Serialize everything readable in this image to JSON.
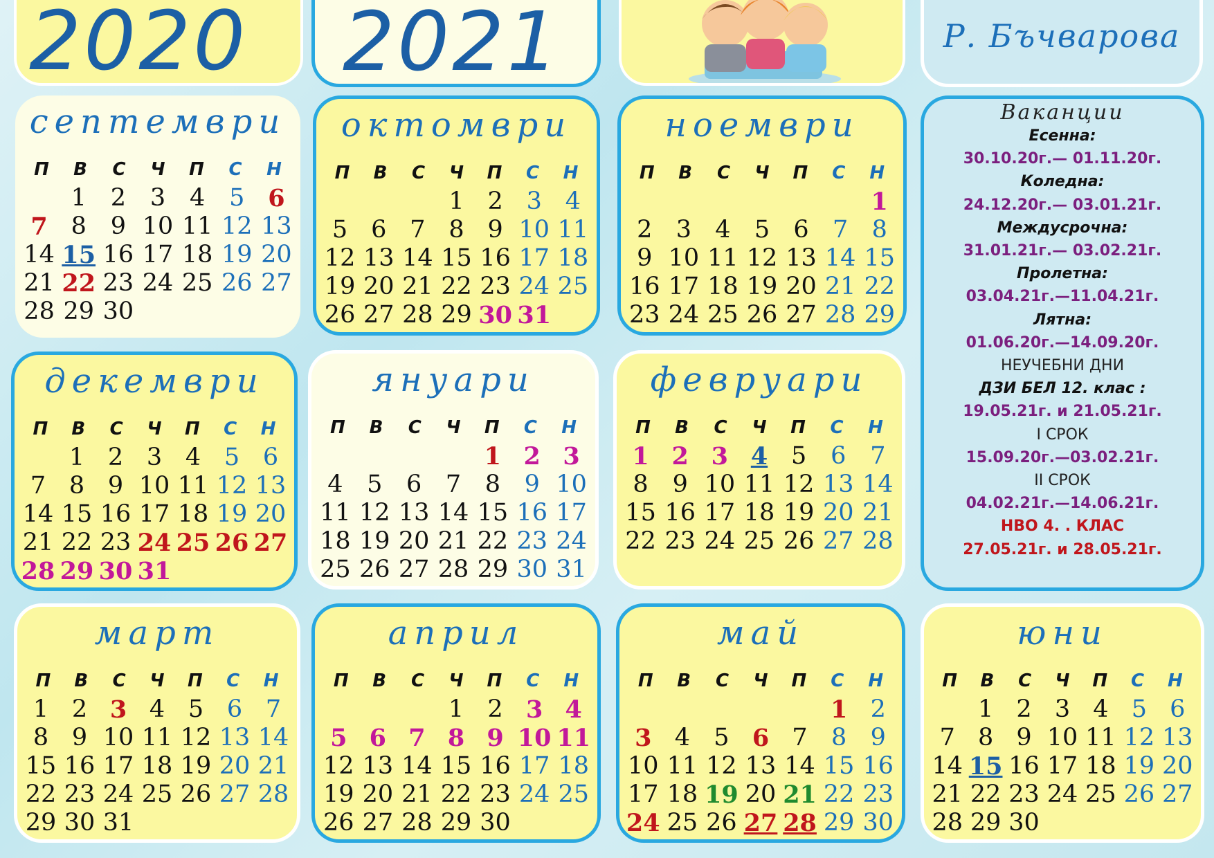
{
  "header": {
    "year1": "2020",
    "year2": "2021",
    "author": "Р. Бъчварова"
  },
  "weekdays": [
    "П",
    "В",
    "С",
    "Ч",
    "П",
    "С",
    "Н"
  ],
  "months": [
    {
      "name": "септември",
      "lead": 1,
      "days": [
        30
      ],
      "red": [
        6,
        7,
        22
      ],
      "mag": [],
      "grn": [],
      "ublu": [
        15
      ],
      "und": []
    },
    {
      "name": "октомври",
      "lead": 3,
      "days": [
        31
      ],
      "red": [],
      "mag": [
        30,
        31
      ],
      "grn": [],
      "ublu": [],
      "und": []
    },
    {
      "name": "ноември",
      "lead": 6,
      "days": [
        30
      ],
      "red": [],
      "mag": [
        1
      ],
      "grn": [],
      "ublu": [],
      "und": []
    },
    {
      "name": "декември",
      "lead": 1,
      "days": [
        31
      ],
      "red": [
        24,
        25,
        26,
        27
      ],
      "mag": [
        28,
        29,
        30,
        31
      ],
      "grn": [],
      "ublu": [],
      "und": []
    },
    {
      "name": "януари",
      "lead": 4,
      "days": [
        31
      ],
      "red": [
        1
      ],
      "mag": [
        2,
        3
      ],
      "grn": [],
      "ublu": [],
      "und": []
    },
    {
      "name": "февруари",
      "lead": 0,
      "days": [
        28
      ],
      "red": [],
      "mag": [
        1,
        2,
        3
      ],
      "grn": [],
      "ublu": [
        4
      ],
      "und": []
    },
    {
      "name": "март",
      "lead": 0,
      "days": [
        31
      ],
      "red": [
        3
      ],
      "mag": [],
      "grn": [],
      "ublu": [],
      "und": []
    },
    {
      "name": "април",
      "lead": 3,
      "days": [
        30
      ],
      "red": [],
      "mag": [
        3,
        4,
        5,
        6,
        7,
        8,
        9,
        10,
        11
      ],
      "grn": [],
      "ublu": [],
      "und": []
    },
    {
      "name": "май",
      "lead": 5,
      "days": [
        31
      ],
      "red": [
        1,
        3,
        6,
        24,
        27,
        28
      ],
      "mag": [],
      "grn": [
        19,
        21
      ],
      "ublu": [],
      "und": [
        27,
        28
      ]
    },
    {
      "name": "юни",
      "lead": 1,
      "days": [
        30
      ],
      "red": [],
      "mag": [],
      "grn": [],
      "ublu": [
        15
      ],
      "und": []
    }
  ],
  "vacations": {
    "title": "Ваканции",
    "items": [
      {
        "k": "vh",
        "t": "Есенна:"
      },
      {
        "k": "vd",
        "t": "30.10.20г.— 01.11.20г."
      },
      {
        "k": "vh",
        "t": "Коледна:"
      },
      {
        "k": "vd",
        "t": "24.12.20г.— 03.01.21г."
      },
      {
        "k": "vh",
        "t": "Междусрочна:"
      },
      {
        "k": "vd",
        "t": "31.01.21г.— 03.02.21г."
      },
      {
        "k": "vh",
        "t": "Пролетна:"
      },
      {
        "k": "vd",
        "t": "03.04.21г.—11.04.21г."
      },
      {
        "k": "vh",
        "t": "Лятна:"
      },
      {
        "k": "vd",
        "t": "01.06.20г.—14.09.20г."
      },
      {
        "k": "vn",
        "t": "НЕУЧЕБНИ ДНИ"
      },
      {
        "k": "vh",
        "t": "ДЗИ БЕЛ 12. клас :"
      },
      {
        "k": "vd",
        "t": "19.05.21г. и 21.05.21г."
      },
      {
        "k": "vn",
        "t": "I СРОК"
      },
      {
        "k": "vd",
        "t": "15.09.20г.—03.02.21г."
      },
      {
        "k": "vn",
        "t": "II СРОК"
      },
      {
        "k": "vd",
        "t": "04.02.21г.—14.06.21г."
      },
      {
        "k": "vr",
        "t": "НВО 4. .  КЛАС"
      },
      {
        "k": "vr",
        "t": "27.05.21г. и 28.05.21г."
      }
    ]
  }
}
